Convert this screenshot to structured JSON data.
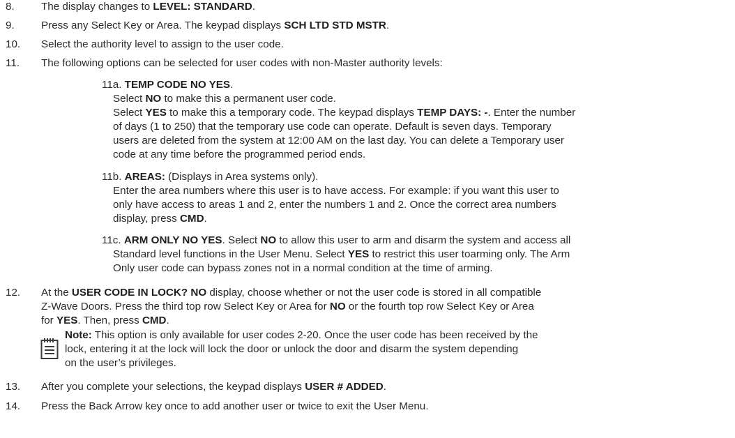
{
  "items": {
    "i8": {
      "num": "8.",
      "pre": "The display changes to ",
      "b1": "LEVEL: STANDARD",
      "post": "."
    },
    "i9": {
      "num": "9.",
      "pre": "Press any Select Key or Area. The keypad displays ",
      "b1": "SCH LTD STD MSTR",
      "post": "."
    },
    "i10": {
      "num": "10.",
      "text": "Select the authority level to assign to the user code."
    },
    "i11": {
      "num": "11.",
      "text": "The following options can be selected for user codes with non-Master authority levels:"
    },
    "i11a": {
      "label": "11a.",
      "b_title": "TEMP CODE NO YES",
      "title_post": ".",
      "l1_pre": "Select ",
      "l1_b": "NO",
      "l1_post": " to make this a permanent user code.",
      "l2_pre": "Select ",
      "l2_b": "YES",
      "l2_mid": " to make this a temporary code. The keypad displays ",
      "l2_b2": "TEMP DAYS: -",
      "l2_post": ". Enter the number",
      "l3": "of days (1 to 250) that the temporary use code can operate. Default is seven days. Temporary",
      "l4": "users are deleted from the system at 12:00 AM on the last day. You can delete a Temporary user",
      "l5": "code at any time before the programmed period ends."
    },
    "i11b": {
      "label": "11b.",
      "b_title": "AREAS:",
      "title_post": " (Displays in Area systems only).",
      "l1": "Enter the area numbers where this user is to have access. For example: if you want this user to",
      "l2": "only have access to areas 1 and 2, enter the numbers 1 and 2. Once the correct area numbers",
      "l3_pre": "display, press ",
      "l3_b": "CMD",
      "l3_post": "."
    },
    "i11c": {
      "label": "11c.",
      "b_title": "ARM ONLY NO YES",
      "t_mid": ". Select ",
      "t_b2": "NO",
      "t_post": " to allow this user to arm and disarm the system and access all",
      "l2_pre": "Standard level functions in the User Menu. Select ",
      "l2_b": "YES",
      "l2_post": " to restrict this user toarming only. The Arm",
      "l3": "Only user code can bypass zones not in a normal condition at the time of arming."
    },
    "i12": {
      "num": "12.",
      "l1_pre": "At the ",
      "l1_b": "USER CODE IN LOCK? NO",
      "l1_post": " display, choose whether or not the user code is stored in all compatible",
      "l2_pre": "Z-Wave Doors. Press the third top row Select Key or Area for ",
      "l2_b": "NO",
      "l2_post": " or the fourth top row Select Key or Area",
      "l3_pre": "for ",
      "l3_b": "YES",
      "l3_mid": ". Then, press ",
      "l3_b2": "CMD",
      "l3_post": ".",
      "note_b": "Note:",
      "note_l1": " This option is only available for user codes 2-20. Once the user code has been received by the",
      "note_l2": "lock, entering it at the lock will lock the door or unlock the door and disarm the system depending",
      "note_l3": "on the user’s privileges."
    },
    "i13": {
      "num": "13.",
      "pre": "After you complete your selections, the keypad displays ",
      "b1": "USER # ADDED",
      "post": "."
    },
    "i14": {
      "num": "14.",
      "text": "Press the Back Arrow key once to add another user or twice to exit the User Menu."
    }
  },
  "icons": {
    "note": "notepad-icon"
  },
  "colors": {
    "text": "#2a2a2a",
    "icon": "#3a3a3a"
  }
}
